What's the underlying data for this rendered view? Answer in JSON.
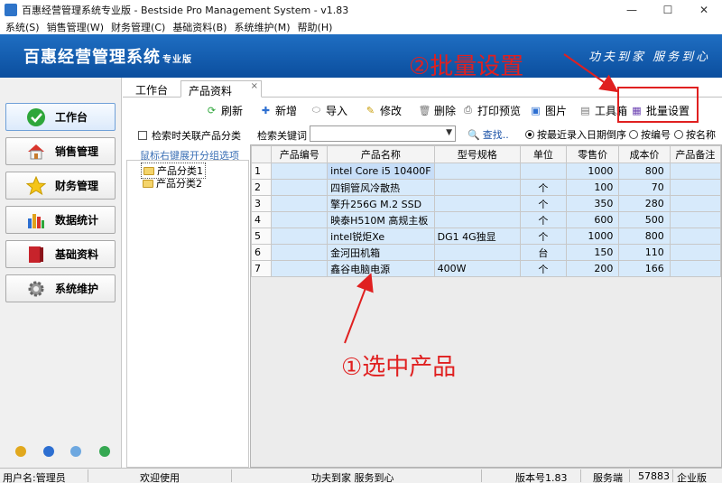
{
  "window": {
    "title": "百惠经营管理系统专业版 - Bestside Pro Management System - v1.83",
    "controls": {
      "minimize": "—",
      "maximize": "☐",
      "close": "✕"
    }
  },
  "menu": [
    "系统(S)",
    "销售管理(W)",
    "财务管理(C)",
    "基础资料(B)",
    "系统维护(M)",
    "帮助(H)"
  ],
  "banner": {
    "brand": "百惠经营管理系统",
    "edition": "专业版",
    "slogan": "功夫到家 服务到心"
  },
  "nav": [
    {
      "label": "工作台",
      "icon": "check-icon"
    },
    {
      "label": "销售管理",
      "icon": "house-icon"
    },
    {
      "label": "财务管理",
      "icon": "star-icon"
    },
    {
      "label": "数据统计",
      "icon": "bar-chart-icon"
    },
    {
      "label": "基础资料",
      "icon": "book-icon"
    },
    {
      "label": "系统维护",
      "icon": "gear-icon"
    }
  ],
  "tabs": [
    {
      "label": "工作台"
    },
    {
      "label": "产品资料"
    }
  ],
  "toolbar": {
    "refresh": "刷新",
    "add": "新增",
    "import": "导入",
    "edit": "修改",
    "delete": "删除",
    "print_preview": "打印预览",
    "image": "图片",
    "toolbox": "工具箱",
    "batch": "批量设置"
  },
  "category": {
    "include_subcategory": "检索时关联产品分类",
    "hint": "鼠标右键展开分组选项",
    "nodes": [
      "产品分类1",
      "产品分类2"
    ]
  },
  "search": {
    "label": "检索关键词",
    "value": "",
    "find": "查找..",
    "sort_options": [
      "按最近录入日期倒序",
      "按编号",
      "按名称"
    ],
    "sort_selected": "按最近录入日期倒序"
  },
  "grid": {
    "columns": [
      "",
      "产品编号",
      "产品名称",
      "型号规格",
      "单位",
      "零售价",
      "成本价",
      "产品备注"
    ],
    "rows": [
      {
        "n": "1",
        "code": "",
        "name": "intel Core i5 10400F",
        "spec": "",
        "unit": "",
        "retail": "1000",
        "cost": "800",
        "note": ""
      },
      {
        "n": "2",
        "code": "",
        "name": "四铜管风冷散热",
        "spec": "",
        "unit": "个",
        "retail": "100",
        "cost": "70",
        "note": ""
      },
      {
        "n": "3",
        "code": "",
        "name": "擎升256G M.2 SSD",
        "spec": "",
        "unit": "个",
        "retail": "350",
        "cost": "280",
        "note": ""
      },
      {
        "n": "4",
        "code": "",
        "name": "映泰H510M 高规主板",
        "spec": "",
        "unit": "个",
        "retail": "600",
        "cost": "500",
        "note": ""
      },
      {
        "n": "5",
        "code": "",
        "name": "intel锐炬Xe",
        "spec": "DG1 4G独显",
        "unit": "个",
        "retail": "1000",
        "cost": "800",
        "note": ""
      },
      {
        "n": "6",
        "code": "",
        "name": "金河田机箱",
        "spec": "",
        "unit": "台",
        "retail": "150",
        "cost": "110",
        "note": ""
      },
      {
        "n": "7",
        "code": "",
        "name": "鑫谷电脑电源",
        "spec": "400W",
        "unit": "个",
        "retail": "200",
        "cost": "166",
        "note": ""
      }
    ]
  },
  "statusbar": {
    "user": "用户名:管理员",
    "welcome": "欢迎使用",
    "motto": "功夫到家 服务到心",
    "version": "版本号1.83",
    "server": "服务端",
    "port": "57883",
    "edition": "企业版"
  },
  "annotations": {
    "step1": "①选中产品",
    "step2": "②批量设置",
    "color": "#e02020"
  }
}
